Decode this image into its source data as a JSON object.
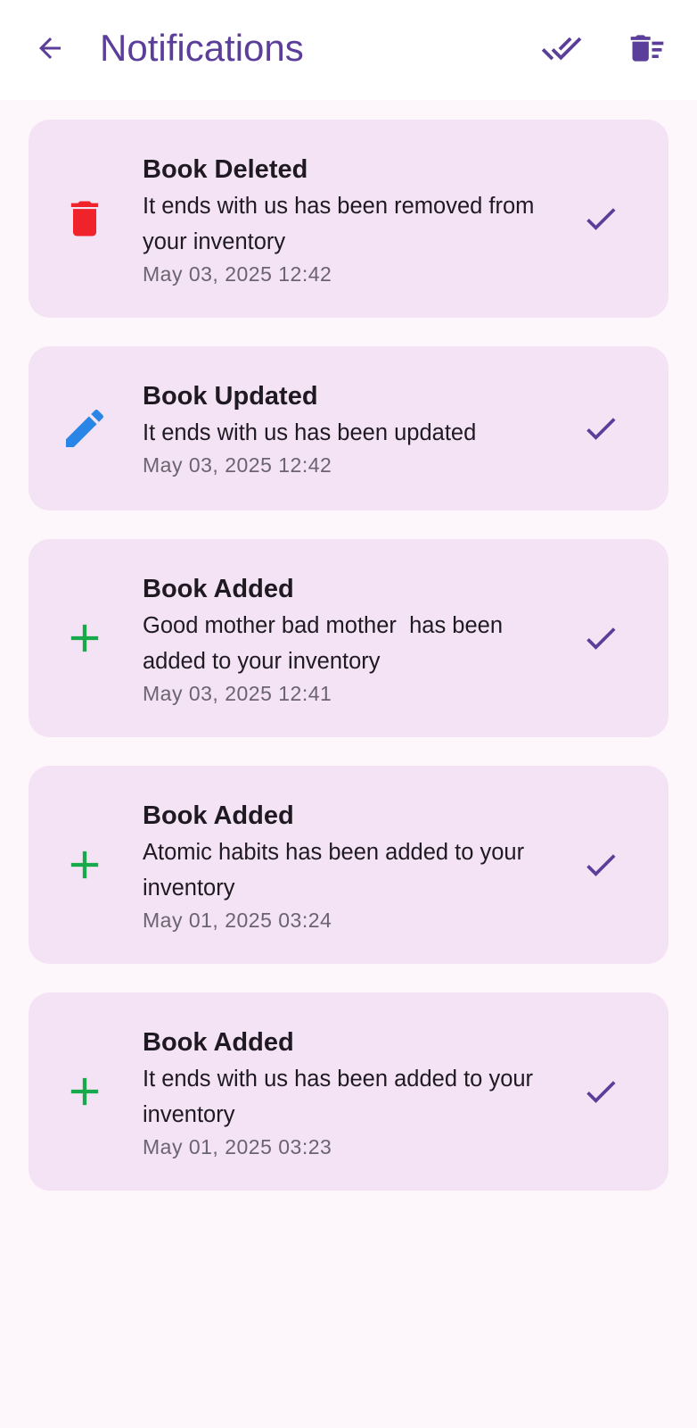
{
  "header": {
    "title": "Notifications",
    "back_icon": "arrow-back-icon",
    "mark_all_icon": "done-all-icon",
    "clear_all_icon": "delete-sweep-icon",
    "accent_color": "#5b3e9a"
  },
  "notifications": [
    {
      "type": "deleted",
      "icon": "trash-icon",
      "icon_color": "#f0232a",
      "title": "Book Deleted",
      "message": "It ends with us has been removed from your inventory",
      "time": "May 03, 2025 12:42"
    },
    {
      "type": "updated",
      "icon": "pencil-icon",
      "icon_color": "#2a86e6",
      "title": "Book Updated",
      "message": "It ends with us has been updated",
      "time": "May 03, 2025 12:42"
    },
    {
      "type": "added",
      "icon": "plus-icon",
      "icon_color": "#17a94a",
      "title": "Book Added",
      "message": "Good mother bad mother  has been added to your inventory",
      "time": "May 03, 2025 12:41"
    },
    {
      "type": "added",
      "icon": "plus-icon",
      "icon_color": "#17a94a",
      "title": "Book Added",
      "message": "Atomic habits has been added to your inventory",
      "time": "May 01, 2025 03:24"
    },
    {
      "type": "added",
      "icon": "plus-icon",
      "icon_color": "#17a94a",
      "title": "Book Added",
      "message": "It ends with us has been added to your inventory",
      "time": "May 01, 2025 03:23"
    }
  ]
}
